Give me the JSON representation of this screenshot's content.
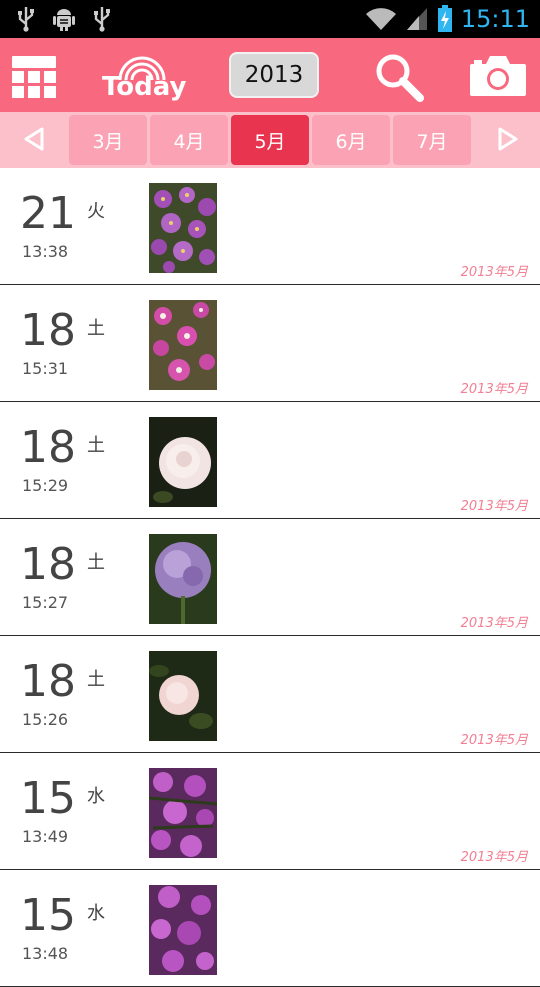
{
  "status_bar": {
    "time": "15:11",
    "left_icons": [
      "usb-icon",
      "android-debug-icon",
      "usb-icon"
    ],
    "right_icons": [
      "wifi-icon",
      "signal-icon",
      "battery-charging-icon"
    ]
  },
  "action_bar": {
    "today_label": "Today",
    "year": "2013",
    "icons": [
      "grid-menu-icon",
      "search-icon",
      "camera-icon"
    ]
  },
  "months": {
    "prev_icon": "triangle-left-icon",
    "next_icon": "triangle-right-icon",
    "tabs": [
      "3月",
      "4月",
      "5月",
      "6月",
      "7月"
    ],
    "active": "5月"
  },
  "entries": [
    {
      "day": "21",
      "weekday": "火",
      "time": "13:38",
      "year_month": "2013年5月",
      "thumb": "purple-daisies"
    },
    {
      "day": "18",
      "weekday": "土",
      "time": "15:31",
      "year_month": "2013年5月",
      "thumb": "magenta-daisies"
    },
    {
      "day": "18",
      "weekday": "土",
      "time": "15:29",
      "year_month": "2013年5月",
      "thumb": "white-rose"
    },
    {
      "day": "18",
      "weekday": "土",
      "time": "15:27",
      "year_month": "2013年5月",
      "thumb": "allium"
    },
    {
      "day": "18",
      "weekday": "土",
      "time": "15:26",
      "year_month": "2013年5月",
      "thumb": "pale-rose"
    },
    {
      "day": "15",
      "weekday": "水",
      "time": "13:49",
      "year_month": "2013年5月",
      "thumb": "azalea"
    },
    {
      "day": "15",
      "weekday": "水",
      "time": "13:48",
      "year_month": "",
      "thumb": "azalea"
    }
  ],
  "colors": {
    "action_bar": "#f8697f",
    "month_strip": "#fcc0cb",
    "month_tab": "#fba3b4",
    "month_tab_active": "#e8344f",
    "year_month_text": "#f27f93",
    "clock": "#2fb6f0"
  }
}
